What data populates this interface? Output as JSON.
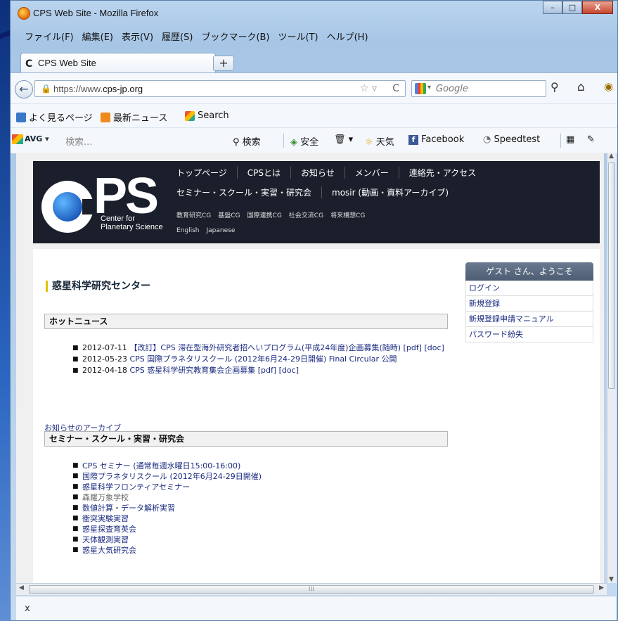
{
  "window": {
    "title": "CPS Web Site - Mozilla Firefox",
    "controls": [
      "–",
      "□",
      "X"
    ]
  },
  "menubar": {
    "items": [
      "ファイル(F)",
      "編集(E)",
      "表示(V)",
      "履歴(S)",
      "ブックマーク(B)",
      "ツール(T)",
      "ヘルプ(H)"
    ]
  },
  "tabs": {
    "active_label": "CPS Web Site",
    "new_tab_label": "+"
  },
  "navbar": {
    "url_prefix": "https://www.",
    "url_domain": "cps-jp.org",
    "search_placeholder": "Google"
  },
  "bookmarks": {
    "items": [
      "よく見るページ",
      "最新ニュース",
      "Search"
    ]
  },
  "avg_toolbar": {
    "logo": "AVG",
    "search_placeholder": "検索...",
    "search_button": "検索",
    "safe": "安全",
    "weather": "天気",
    "facebook": "Facebook",
    "speedtest": "Speedtest"
  },
  "site": {
    "logo_text": "PS",
    "logo_sub1": "Center for",
    "logo_sub2": "Planetary Science",
    "nav_main": [
      "トップページ",
      "CPSとは",
      "お知らせ",
      "メンバー",
      "連絡先・アクセス"
    ],
    "nav_second": [
      "セミナー・スクール・実習・研究会",
      "mosir (動画・資料アーカイブ)"
    ],
    "nav_cg": [
      "教育研究CG",
      "基盤CG",
      "国際連携CG",
      "社会交流CG",
      "将来構想CG"
    ],
    "nav_lang": [
      "English",
      "Japanese"
    ]
  },
  "content": {
    "page_title": "惑星科学研究センター",
    "hot_news_heading": "ホットニュース",
    "news": [
      {
        "date": "2012-07-11",
        "text": "【改訂】CPS 滞在型海外研究者招へいプログラム(平成24年度)企画募集(随時) [pdf] [doc]"
      },
      {
        "date": "2012-05-23",
        "text": "CPS 国際プラネタリスクール (2012年6月24-29日開催) Final Circular 公開"
      },
      {
        "date": "2012-04-18",
        "text": "CPS 惑星科学研究教育集会企画募集 [pdf] [doc]"
      }
    ],
    "archive_link": "お知らせのアーカイブ",
    "seminar_heading": "セミナー・スクール・実習・研究会",
    "seminars": [
      "CPS セミナー (通常毎週水曜日15:00-16:00)",
      "国際プラネタリスクール (2012年6月24-29日開催)",
      "惑星科学フロンティアセミナー",
      "森羅万象学校",
      "数値計算・データ解析実習",
      "衝突実験実習",
      "惑星探査育英会",
      "天体観測実習",
      "惑星大気研究会"
    ]
  },
  "sidebar": {
    "greeting": "ゲスト さん、ようこそ",
    "links": [
      "ログイン",
      "新規登録",
      "新規登録申請マニュアル",
      "パスワード紛失"
    ]
  },
  "status": {
    "close_label": "x"
  }
}
